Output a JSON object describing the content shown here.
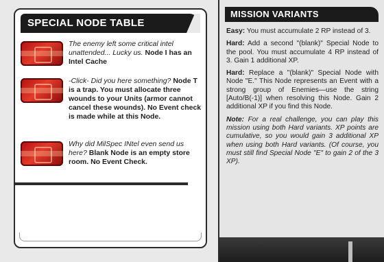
{
  "special_node_table": {
    "title": "SPECIAL NODE TABLE",
    "nodes": [
      {
        "icon": "red-node-tile-icon",
        "flavor": "The enemy left some critical intel unattended... Lucky us.",
        "effect": "Node I has an Intel Cache"
      },
      {
        "icon": "red-node-tile-icon",
        "flavor": "-Click- Did you here something?",
        "effect": "Node T is a trap. You must allocate three wounds to your Units (armor cannot cancel these wounds). No Event check is made while at this Node."
      },
      {
        "icon": "red-node-tile-icon",
        "flavor": "Why did MilSpec INtel even send us here?",
        "effect": "Blank Node is an empty store room. No Event Check."
      }
    ]
  },
  "mission_variants": {
    "title": "MISSION VARIANTS",
    "easy_label": "Easy:",
    "easy_text": "You must accumulate 2 RP instead of 3.",
    "hard1_label": "Hard:",
    "hard1_text": "Add a second \"(blank)\" Special Node to the pool. You must accumulate 4 RP instead of 3. Gain 1 additional XP.",
    "hard2_label": "Hard:",
    "hard2_text": "Replace a \"(blank)\" Special Node with Node \"E.\" This Node represents an Event with a strong group of Enemies—use the string [Auto/B(-1)] when resolving this Node. Gain 2 additional XP if you find this Node.",
    "note_label": "Note:",
    "note_text": "For a real challenge, you can play this mission using both Hard variants. XP points are cumulative, so you would gain 3 additional XP when using both Hard variants. (Of course, you must still find Special Node \"E\" to gain 2 of the 3 XP)."
  }
}
